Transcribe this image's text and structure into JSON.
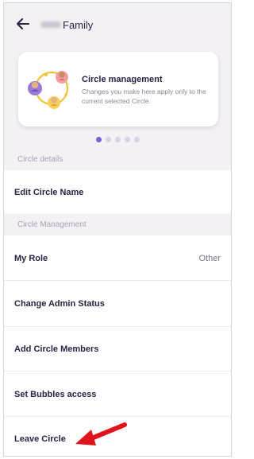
{
  "header": {
    "title": "Family"
  },
  "card": {
    "title": "Circle management",
    "description": "Changes you make here apply only to the current selected Circle.",
    "carousel_count": 5,
    "carousel_active": 0
  },
  "sections": {
    "details": "Circle details",
    "management": "Circle Management"
  },
  "items": {
    "edit_name": "Edit Circle Name",
    "my_role": "My Role",
    "my_role_value": "Other",
    "change_admin": "Change Admin Status",
    "add_members": "Add Circle Members",
    "bubbles": "Set Bubbles access",
    "leave": "Leave Circle"
  },
  "colors": {
    "accent": "#7a5fd0",
    "annotation_arrow": "#e0151b",
    "text_primary": "#2a1f45",
    "section_bg": "#f4f1f5"
  }
}
